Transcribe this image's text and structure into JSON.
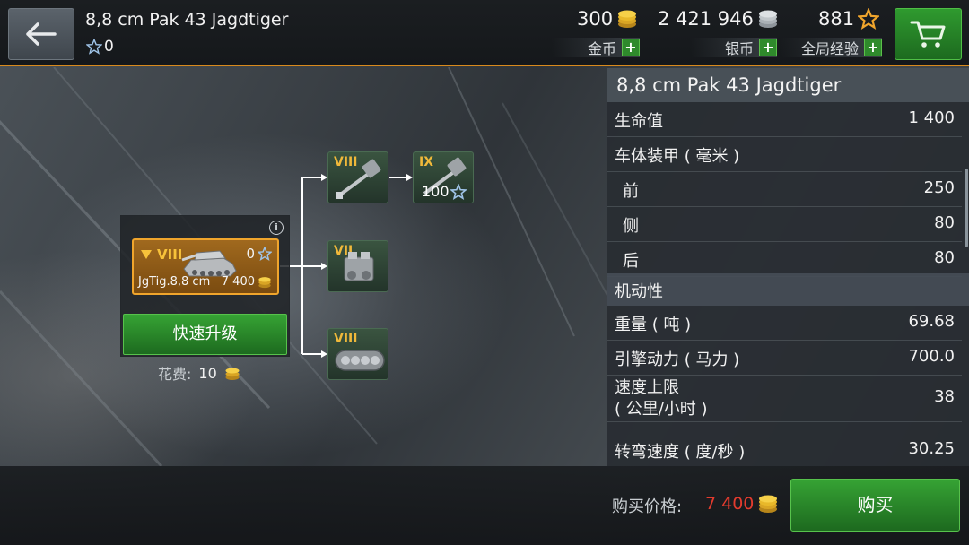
{
  "header": {
    "title": "8,8 cm Pak 43 Jagdtiger",
    "xp": "0",
    "currencies": [
      {
        "value": "300",
        "label": "金币"
      },
      {
        "value": "2 421 946",
        "label": "银币"
      },
      {
        "value": "881",
        "label": "全局经验"
      }
    ],
    "plus_symbol": "+"
  },
  "tree": {
    "tank": {
      "tier": "VIII",
      "xp": "0",
      "name": "JgTig.8,8 cm",
      "price": "7 400"
    },
    "upgrade_label": "快速升级",
    "cost_label": "花费:",
    "cost_value": "10",
    "modules": [
      {
        "tier": "VIII",
        "type": "gun-icon"
      },
      {
        "tier": "IX",
        "type": "gun-icon",
        "xp": "100"
      },
      {
        "tier": "VII",
        "type": "engine-icon"
      },
      {
        "tier": "VIII",
        "type": "tracks-icon"
      }
    ]
  },
  "stats": {
    "title": "8,8 cm Pak 43 Jagdtiger",
    "rows": [
      {
        "label": "生命值",
        "value": "1 400"
      },
      {
        "label": "车体装甲 ( 毫米 )",
        "value": ""
      },
      {
        "label": "前",
        "value": "250"
      },
      {
        "label": "侧",
        "value": "80"
      },
      {
        "label": "后",
        "value": "80"
      },
      {
        "label": "机动性",
        "value": ""
      },
      {
        "label": "重量 ( 吨 )",
        "value": "69.68"
      },
      {
        "label": "引擎动力 ( 马力 )",
        "value": "700.0"
      },
      {
        "label": "速度上限",
        "label2": "( 公里/小时 )",
        "value": "38"
      },
      {
        "label": "转弯速度 ( 度/秒 )",
        "value": "30.25"
      }
    ]
  },
  "footer": {
    "price_label": "购买价格:",
    "price_value": "7 400",
    "buy_label": "购买"
  },
  "colors": {
    "accent_orange": "#f0a52c",
    "button_green": "#2f9a2f",
    "price_red": "#e33b2e",
    "gold_coin": "#f2c230",
    "silver_coin": "#c7ccd0"
  }
}
